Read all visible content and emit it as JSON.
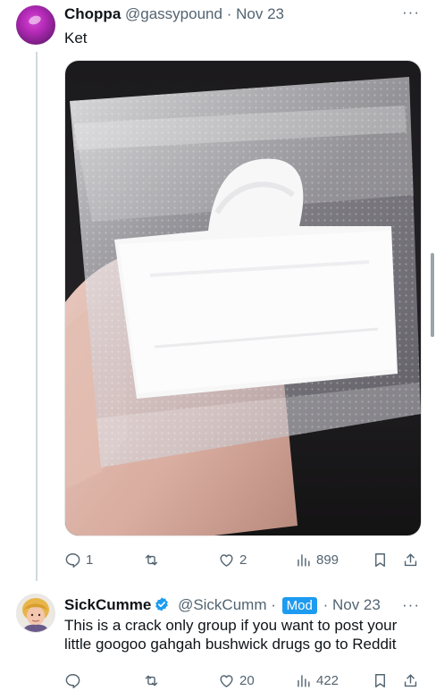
{
  "tweet1": {
    "author_name": "Choppa",
    "handle": "@gassypound",
    "separator": "·",
    "date": "Nov 23",
    "more": "···",
    "text": "Ket",
    "stats": {
      "replies": "1",
      "likes": "2",
      "views": "899"
    }
  },
  "tweet2": {
    "author_name": "SickCumme",
    "handle": "@SickCumm",
    "separator": "·",
    "badge": "Mod",
    "date": "Nov 23",
    "more": "···",
    "text": "This is a crack only group if you want to post your little googoo gahgah bushwick drugs go to Reddit",
    "stats": {
      "likes": "20",
      "views": "422"
    }
  },
  "icons": [
    "reply-icon",
    "retweet-icon",
    "like-icon",
    "views-icon",
    "bookmark-icon",
    "share-icon",
    "verified-badge-icon"
  ],
  "colors": {
    "accent": "#1d9bf0",
    "text": "#0f1419",
    "muted": "#536471",
    "thread_line": "#cfd9de"
  }
}
